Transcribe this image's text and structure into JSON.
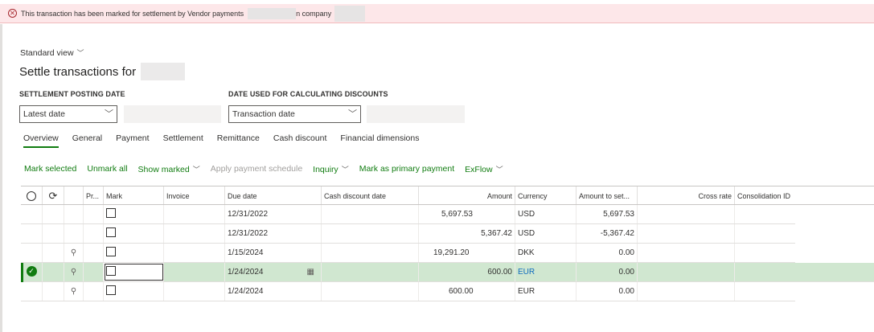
{
  "message": {
    "text_before": "This transaction has been marked for settlement by Vendor payments",
    "text_after": "n company"
  },
  "view": {
    "label": "Standard view"
  },
  "page": {
    "title": "Settle transactions for"
  },
  "settlement_posting_date": {
    "label": "SETTLEMENT POSTING DATE",
    "value": "Latest date"
  },
  "discount_date": {
    "label": "DATE USED FOR CALCULATING DISCOUNTS",
    "value": "Transaction date"
  },
  "tabs": [
    "Overview",
    "General",
    "Payment",
    "Settlement",
    "Remittance",
    "Cash discount",
    "Financial dimensions"
  ],
  "actions": {
    "mark_selected": "Mark selected",
    "unmark_all": "Unmark all",
    "show_marked": "Show marked",
    "apply_payment_schedule": "Apply payment schedule",
    "inquiry": "Inquiry",
    "mark_as_primary": "Mark as primary payment",
    "exflow": "ExFlow"
  },
  "grid": {
    "columns": {
      "pr": "Pr...",
      "mark": "Mark",
      "invoice": "Invoice",
      "due_date": "Due date",
      "cash_discount_date": "Cash discount date",
      "amount": "Amount",
      "currency": "Currency",
      "amount_to_settle": "Amount to set...",
      "cross_rate": "Cross rate",
      "consolidation_id": "Consolidation ID"
    },
    "rows": [
      {
        "due_date": "12/31/2022",
        "amount_debit": "5,697.53",
        "amount_credit": "",
        "currency": "USD",
        "amount_to_settle": "5,697.53",
        "has_user_icon": false,
        "selected": false
      },
      {
        "due_date": "12/31/2022",
        "amount_debit": "",
        "amount_credit": "5,367.42",
        "currency": "USD",
        "amount_to_settle": "-5,367.42",
        "has_user_icon": false,
        "selected": false
      },
      {
        "due_date": "1/15/2024",
        "amount_debit": "19,291.20",
        "amount_credit": "",
        "currency": "DKK",
        "amount_to_settle": "0.00",
        "has_user_icon": true,
        "selected": false
      },
      {
        "due_date": "1/24/2024",
        "amount_debit": "",
        "amount_credit": "600.00",
        "currency": "EUR",
        "amount_to_settle": "0.00",
        "has_user_icon": true,
        "selected": true
      },
      {
        "due_date": "1/24/2024",
        "amount_debit": "600.00",
        "amount_credit": "",
        "currency": "EUR",
        "amount_to_settle": "0.00",
        "has_user_icon": true,
        "selected": false
      }
    ]
  },
  "colors": {
    "accent": "#107c10",
    "error_bg": "#fde7e9",
    "selected_row": "#d0e7d0",
    "link": "#0f6cbd"
  },
  "icons": {
    "error": "error-circle-icon",
    "refresh": "refresh-icon",
    "user": "user-gear-icon",
    "calendar": "calendar-icon",
    "check": "check-circle-icon"
  }
}
